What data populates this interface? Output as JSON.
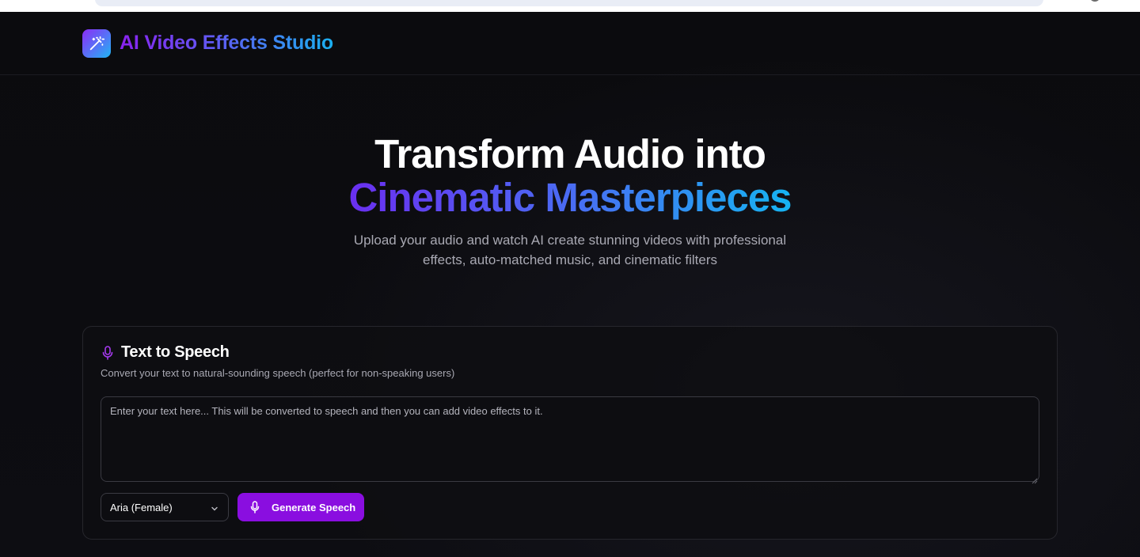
{
  "brand": {
    "name": "AI Video Effects Studio",
    "logo_icon": "magic-wand-icon",
    "gradient": [
      "#8a22f0",
      "#5f5bf3",
      "#1ab0f0"
    ]
  },
  "hero": {
    "title_line1": "Transform Audio into",
    "title_line2": "Cinematic Masterpieces",
    "subtitle": "Upload your audio and watch AI create stunning videos with professional effects, auto-matched music, and cinematic filters"
  },
  "tts_card": {
    "icon": "microphone-icon",
    "title": "Text to Speech",
    "description": "Convert your text to natural-sounding speech (perfect for non-speaking users)",
    "input_value": "",
    "input_placeholder": "Enter your text here... This will be converted to speech and then you can add video effects to it.",
    "voice_selected": "Aria (Female)",
    "generate_label": "Generate Speech"
  },
  "colors": {
    "accent": "#8a0ee0",
    "background": "#0b0b0e",
    "muted_text": "#a9a9b3"
  }
}
